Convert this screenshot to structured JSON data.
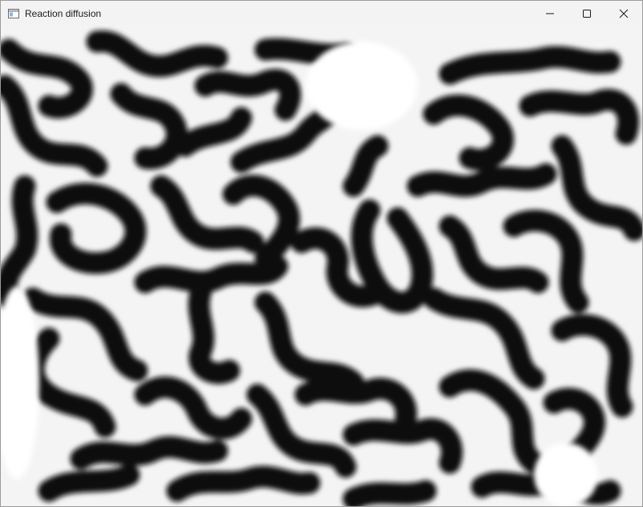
{
  "window": {
    "title": "Reaction diffusion",
    "icon": "app-window-icon",
    "controls": [
      "minimize-icon",
      "maximize-icon",
      "close-icon"
    ]
  },
  "canvas": {
    "content": "reaction-diffusion pattern",
    "colors": {
      "background": "#ffffff",
      "pattern": "#111111"
    }
  }
}
